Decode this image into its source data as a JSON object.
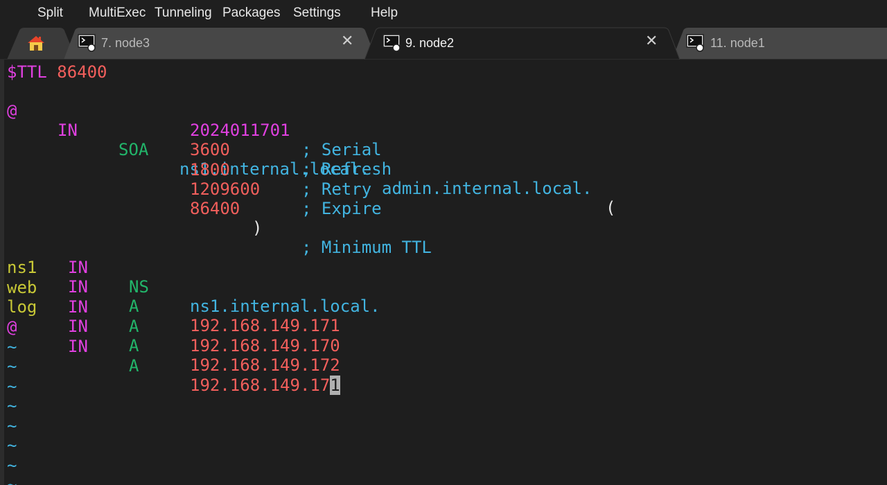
{
  "menu": {
    "split": "Split",
    "multiexec": "MultiExec",
    "tunneling": "Tunneling",
    "packages": "Packages",
    "settings": "Settings",
    "help": "Help"
  },
  "tabs": [
    {
      "label": "7. node3",
      "active": false
    },
    {
      "label": "9. node2",
      "active": true
    },
    {
      "label": "11. node1",
      "active": false
    }
  ],
  "zone": {
    "ttl_directive": "$TTL",
    "ttl_value": "86400",
    "soa": {
      "owner": "@",
      "class": "IN",
      "type": "SOA",
      "primary_ns": "ns1.internal.local.",
      "admin": "admin.internal.local.",
      "open_paren": "(",
      "serial": "2024011701",
      "serial_comment": "; Serial",
      "refresh": "3600",
      "refresh_comment": "; Refresh",
      "retry": "1800",
      "retry_comment": "; Retry",
      "expire": "1209600",
      "expire_comment": "; Expire",
      "minimum": "86400",
      "close_paren": ")",
      "minimum_comment": "; Minimum TTL"
    },
    "records": [
      {
        "owner": "",
        "class": "IN",
        "type": "NS",
        "value": "ns1.internal.local."
      },
      {
        "owner": "ns1",
        "class": "IN",
        "type": "A",
        "value": "192.168.149.171"
      },
      {
        "owner": "web",
        "class": "IN",
        "type": "A",
        "value": "192.168.149.170"
      },
      {
        "owner": "log",
        "class": "IN",
        "type": "A",
        "value": "192.168.149.172"
      },
      {
        "owner": "@",
        "class": "IN",
        "type": "A",
        "value": "192.168.149.17",
        "cursor_char": "1"
      }
    ],
    "tilde": "~"
  },
  "colors": {
    "number": "#f25f5c",
    "keyword": "#e040e0",
    "type": "#22b56a",
    "domain": "#42b4e0",
    "owner": "#c8c836"
  }
}
